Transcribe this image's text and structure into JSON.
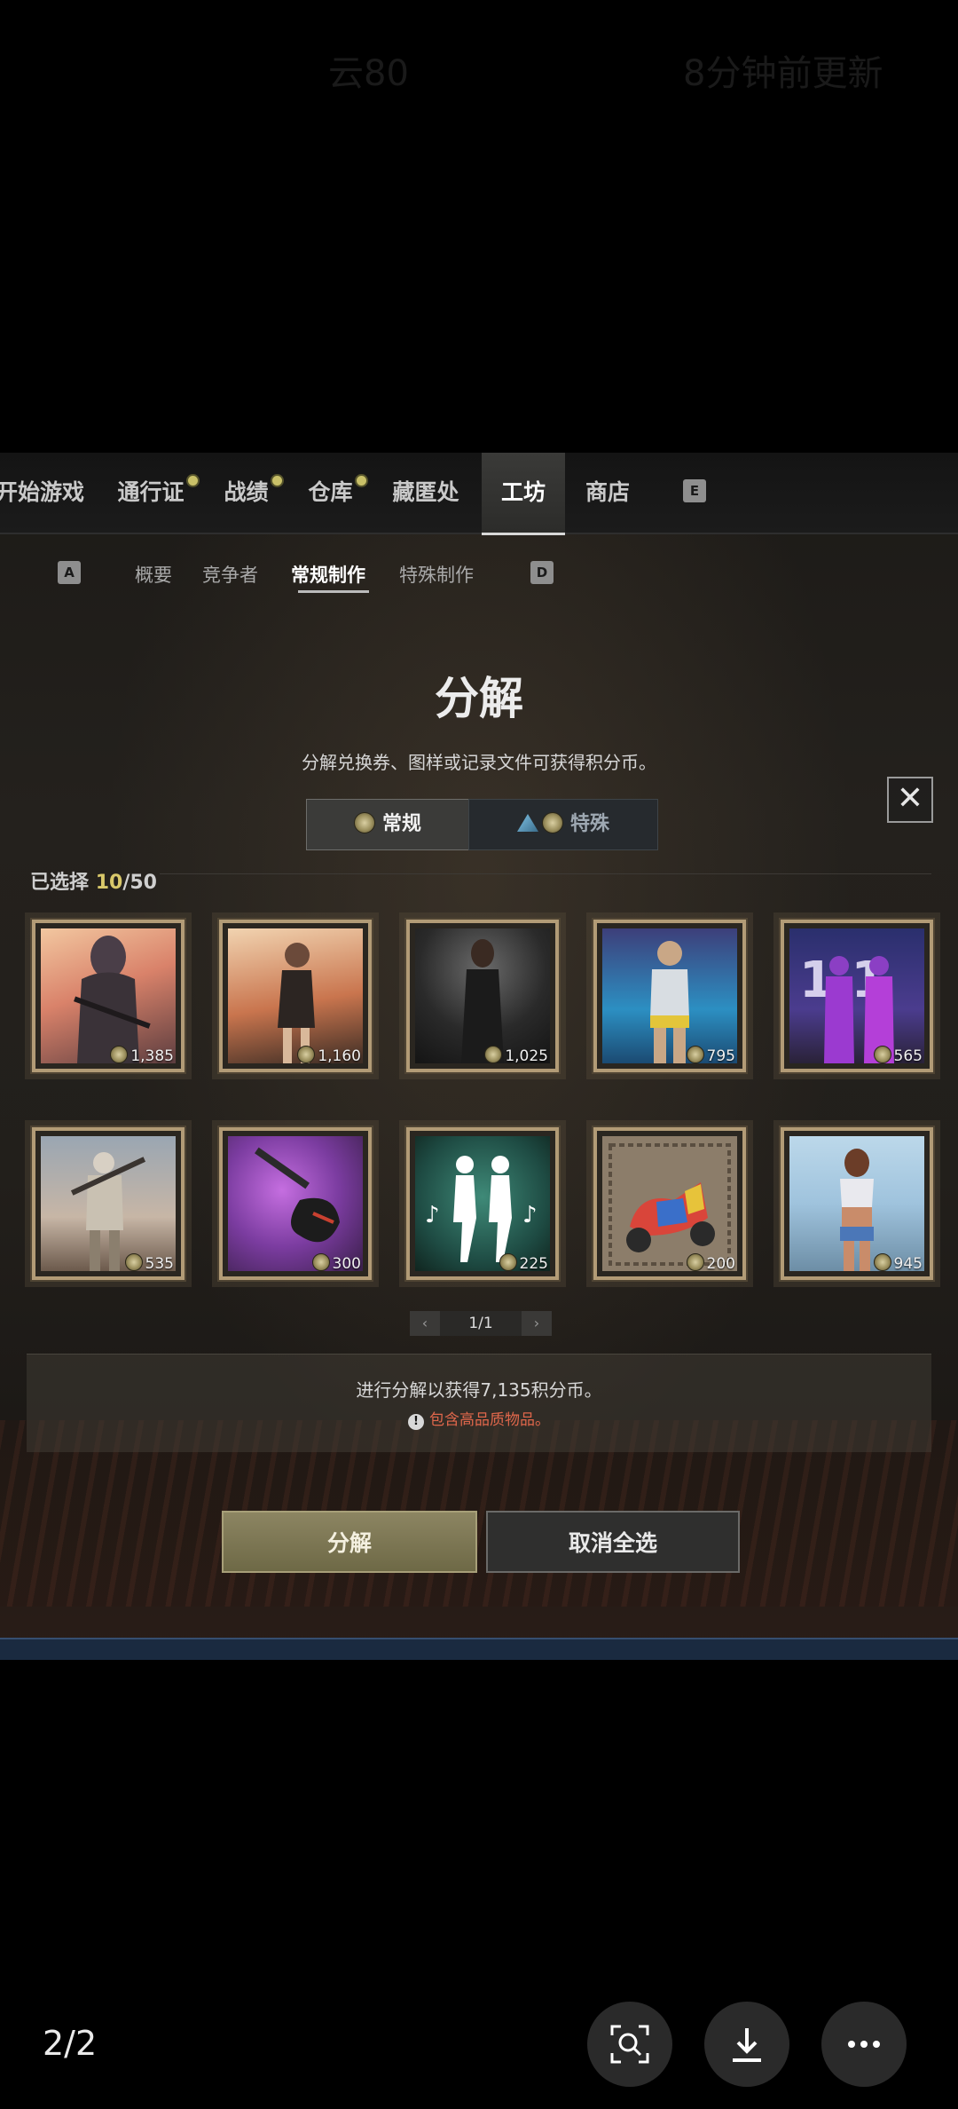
{
  "top_ghost": {
    "left": "云80",
    "right": "8分钟前更新"
  },
  "nav": {
    "items": [
      "开始游戏",
      "通行证",
      "战绩",
      "仓库",
      "藏匿处",
      "工坊",
      "商店"
    ],
    "active": "工坊",
    "key_right": "E"
  },
  "subnav": {
    "key_left": "A",
    "items": [
      "概要",
      "竞争者",
      "常规制作",
      "特殊制作"
    ],
    "active": "常规制作",
    "key_right": "D"
  },
  "modal": {
    "title": "分解",
    "subtitle": "分解兑换券、图样或记录文件可获得积分币。",
    "tabs": {
      "normal": "常规",
      "special": "特殊"
    },
    "selected_prefix": "已选择",
    "selected_count": "10",
    "selected_total": "/50",
    "items": [
      {
        "name": "hooded-sniper",
        "value": "1,385"
      },
      {
        "name": "girl-sunset",
        "value": "1,160"
      },
      {
        "name": "woman-dark-hall",
        "value": "1,025"
      },
      {
        "name": "silver-outfit-girl",
        "value": "795"
      },
      {
        "name": "purple-duo-11-11",
        "value": "565"
      },
      {
        "name": "soldier-ruins",
        "value": "535"
      },
      {
        "name": "electric-guitar",
        "value": "300"
      },
      {
        "name": "dance-emote",
        "value": "225"
      },
      {
        "name": "colorful-scooter",
        "value": "200"
      },
      {
        "name": "girl-beach",
        "value": "945"
      }
    ],
    "pager": "1/1",
    "info": "进行分解以获得7,135积分币。",
    "warning": "包含高品质物品。",
    "buttons": {
      "primary": "分解",
      "secondary": "取消全选"
    }
  },
  "viewer": {
    "page_indicator": "2/2"
  }
}
